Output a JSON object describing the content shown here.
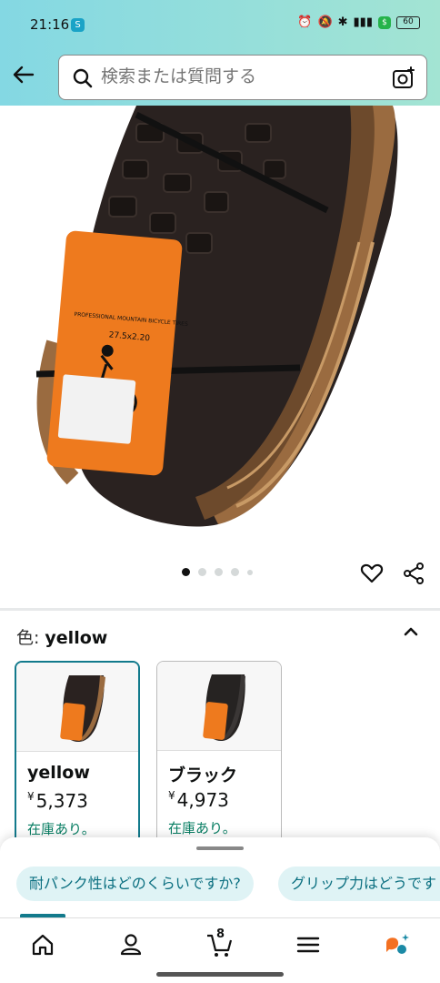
{
  "status": {
    "time": "21:16",
    "battery": "60"
  },
  "search": {
    "placeholder": "検索または質問する"
  },
  "carousel": {
    "total_dots": 5,
    "active_index": 0
  },
  "color_selector": {
    "label": "色:",
    "selected": "yellow",
    "options": [
      {
        "name": "yellow",
        "currency": "¥",
        "price": "5,373",
        "stock": "在庫あり。",
        "selected": true
      },
      {
        "name": "ブラック",
        "currency": "¥",
        "price": "4,973",
        "stock": "在庫あり。",
        "selected": false
      }
    ]
  },
  "suggestions": [
    "耐パンク性はどのくらいですか?",
    "グリップ力はどうです"
  ],
  "nav": {
    "cart_count": "8"
  },
  "colors": {
    "accent": "#127a8c",
    "in_stock": "#067d62",
    "header": "#84d8e3"
  }
}
